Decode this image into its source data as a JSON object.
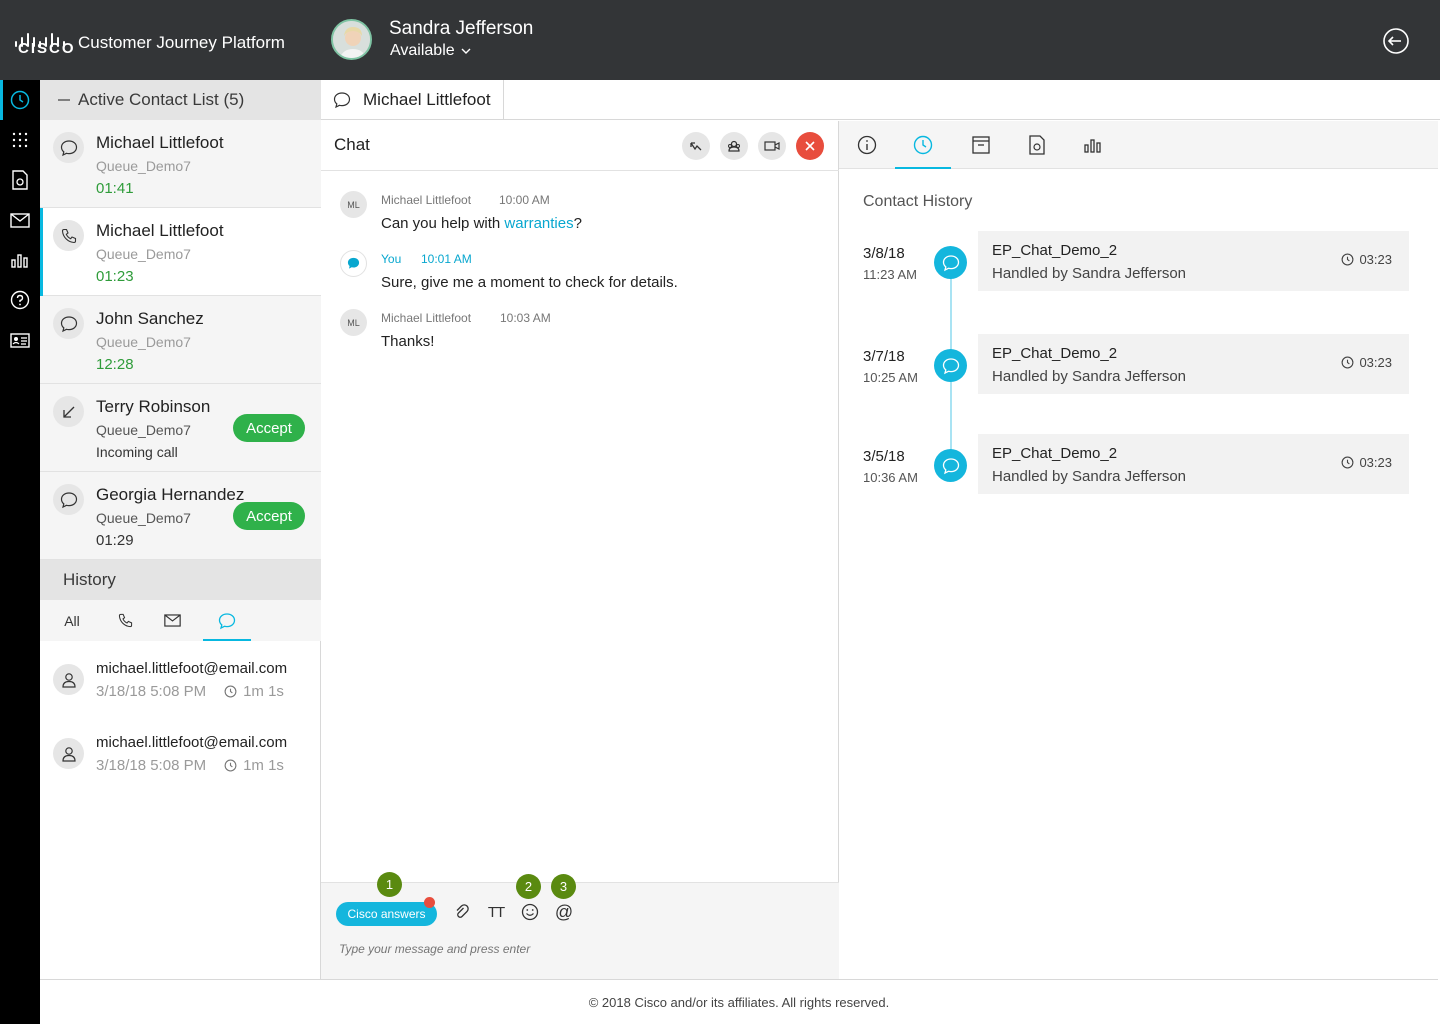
{
  "header": {
    "logo_text": "CISCO",
    "app_title": "Customer Journey Platform",
    "user_name": "Sandra Jefferson",
    "user_status": "Available"
  },
  "rail": {
    "items": [
      "clock-icon",
      "dialpad-icon",
      "document-icon",
      "mail-icon",
      "bar-chart-icon",
      "help-icon",
      "id-card-icon"
    ]
  },
  "contacts": {
    "header": "Active Contact List (5)",
    "items": [
      {
        "name": "Michael Littlefoot",
        "queue": "Queue_Demo7",
        "time": "01:41",
        "icon": "chat-icon"
      },
      {
        "name": "Michael Littlefoot",
        "queue": "Queue_Demo7",
        "time": "01:23",
        "icon": "phone-icon"
      },
      {
        "name": "John Sanchez",
        "queue": "Queue_Demo7",
        "time": "12:28",
        "icon": "chat-icon"
      },
      {
        "name": "Terry Robinson",
        "queue": "Queue_Demo7",
        "status": "Incoming call",
        "accept": "Accept",
        "icon": "incoming-arrow-icon"
      },
      {
        "name": "Georgia Hernandez",
        "queue": "Queue_Demo7",
        "time": "01:29",
        "accept": "Accept",
        "icon": "chat-icon"
      }
    ]
  },
  "history": {
    "header": "History",
    "tabs": {
      "all": "All"
    },
    "items": [
      {
        "email": "michael.littlefoot@email.com",
        "datetime": "3/18/18 5:08 PM",
        "duration": "1m 1s"
      },
      {
        "email": "michael.littlefoot@email.com",
        "datetime": "3/18/18 5:08 PM",
        "duration": "1m 1s"
      }
    ]
  },
  "conversation": {
    "tab_label": "Michael Littlefoot"
  },
  "chat": {
    "title": "Chat",
    "messages": [
      {
        "initials": "ML",
        "sender": "Michael Littlefoot",
        "time": "10:00 AM",
        "text_before": "Can you help with ",
        "link": "warranties",
        "text_after": "?"
      },
      {
        "sender": "You",
        "time": "10:01 AM",
        "text": "Sure, give me a moment to check for details."
      },
      {
        "initials": "ML",
        "sender": "Michael Littlefoot",
        "time": "10:03 AM",
        "text": "Thanks!"
      }
    ],
    "composer": {
      "cisco_answers": "Cisco answers",
      "text_format": "TT",
      "mention": "@",
      "placeholder": "Type your message and press enter",
      "badges": [
        "1",
        "2",
        "3"
      ]
    }
  },
  "details": {
    "title": "Contact History",
    "entries": [
      {
        "date": "3/8/18",
        "time": "11:23 AM",
        "title": "EP_Chat_Demo_2",
        "subtitle": "Handled by Sandra Jefferson",
        "duration": "03:23"
      },
      {
        "date": "3/7/18",
        "time": "10:25 AM",
        "title": "EP_Chat_Demo_2",
        "subtitle": "Handled by Sandra Jefferson",
        "duration": "03:23"
      },
      {
        "date": "3/5/18",
        "time": "10:36 AM",
        "title": "EP_Chat_Demo_2",
        "subtitle": "Handled by Sandra Jefferson",
        "duration": "03:23"
      }
    ]
  },
  "footer": {
    "copyright": "© 2018 Cisco and/or its affiliates. All rights reserved."
  },
  "colors": {
    "accent": "#08b8e0",
    "header_bg": "#333537",
    "accept_green": "#2fb14a",
    "end_red": "#e84d3d",
    "badge_green": "#5a8a10"
  }
}
